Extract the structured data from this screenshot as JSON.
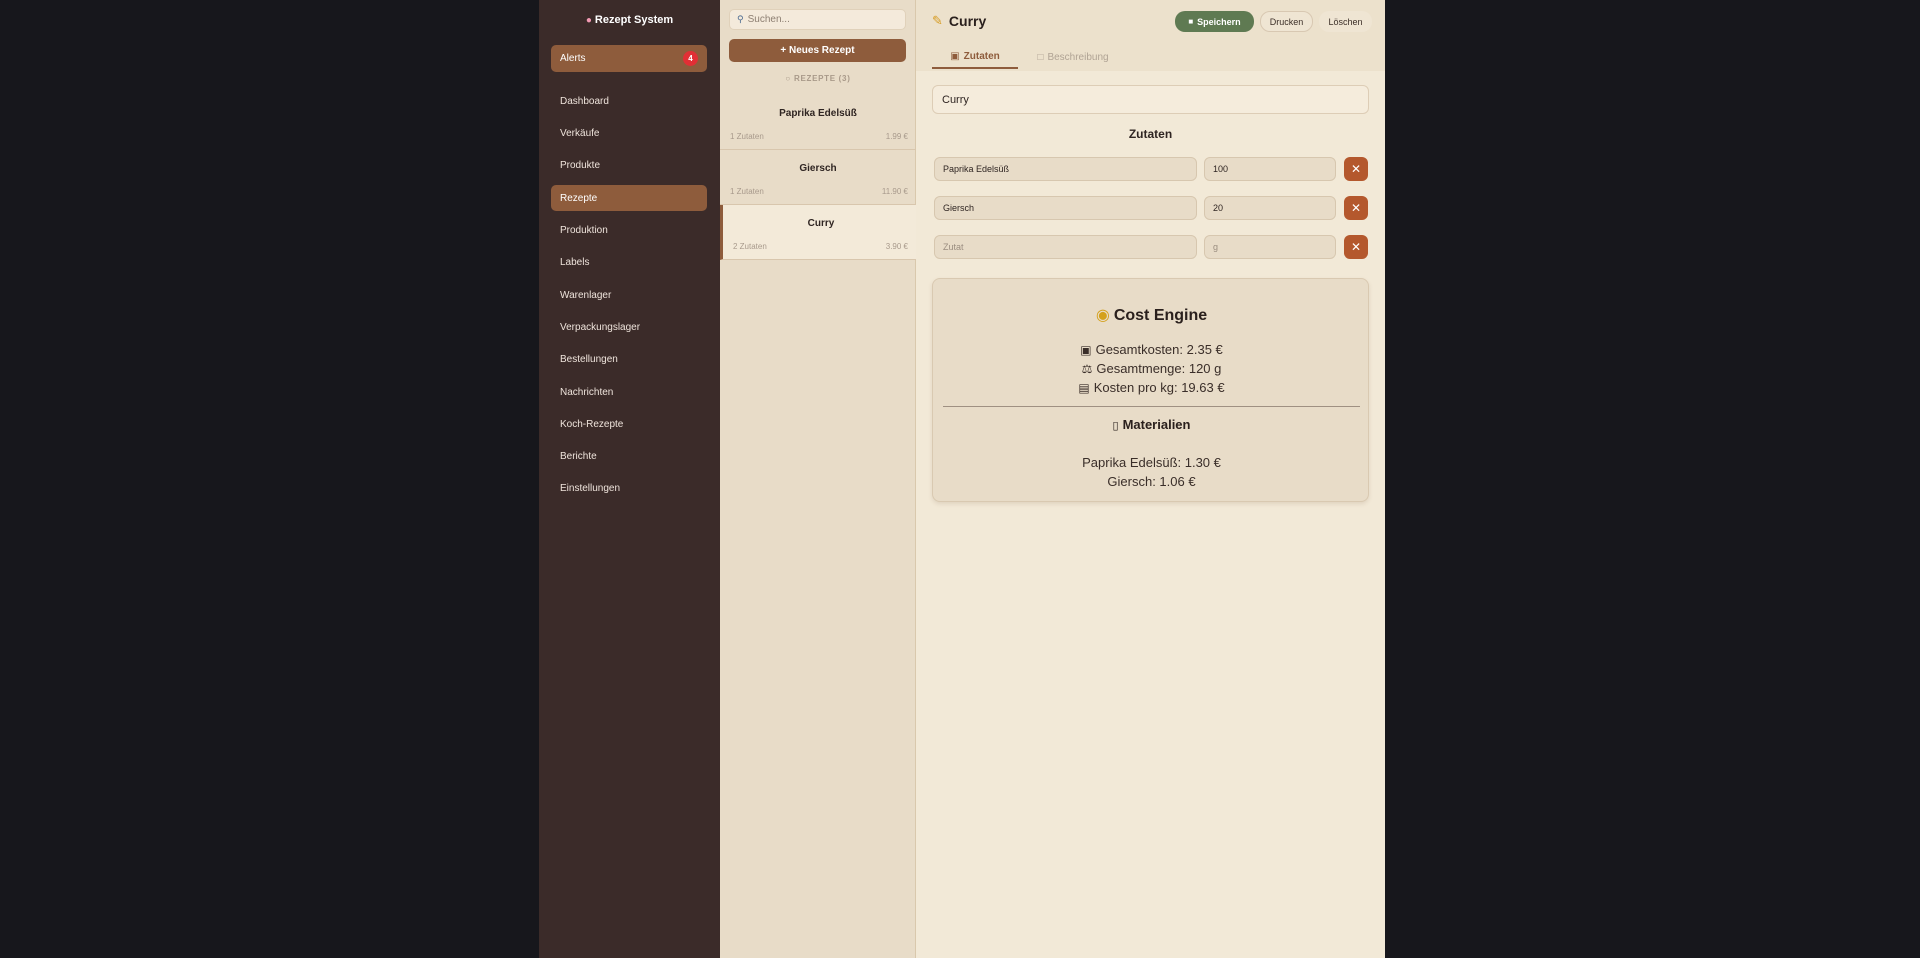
{
  "sidebar": {
    "brand": "Rezept System",
    "alerts_label": "Alerts",
    "alerts_count": "4",
    "items": [
      {
        "label": "Dashboard"
      },
      {
        "label": "Verkäufe"
      },
      {
        "label": "Produkte"
      },
      {
        "label": "Rezepte",
        "active": true
      },
      {
        "label": "Produktion"
      },
      {
        "label": "Labels"
      },
      {
        "label": "Warenlager"
      },
      {
        "label": "Verpackungslager"
      },
      {
        "label": "Bestellungen"
      },
      {
        "label": "Nachrichten"
      },
      {
        "label": "Koch-Rezepte"
      },
      {
        "label": "Berichte"
      },
      {
        "label": "Einstellungen"
      }
    ]
  },
  "list": {
    "search_placeholder": "Suchen...",
    "new_button": "+ Neues Rezept",
    "header": "REZEPTE (3)",
    "recipes": [
      {
        "name": "Paprika Edelsüß",
        "ingredients": "1 Zutaten",
        "price": "1.99 €"
      },
      {
        "name": "Giersch",
        "ingredients": "1 Zutaten",
        "price": "11.90 €"
      },
      {
        "name": "Curry",
        "ingredients": "2 Zutaten",
        "price": "3.90 €",
        "selected": true
      }
    ]
  },
  "editor": {
    "title": "Curry",
    "save_label": "Speichern",
    "print_label": "Drucken",
    "delete_label": "Löschen",
    "tabs": [
      {
        "label": "Zutaten",
        "active": true
      },
      {
        "label": "Beschreibung"
      }
    ],
    "name_value": "Curry",
    "section_title": "Zutaten",
    "ingredients": [
      {
        "name": "Paprika Edelsüß",
        "qty": "100"
      },
      {
        "name": "Giersch",
        "qty": "20"
      }
    ],
    "new_ingredient": {
      "name_placeholder": "Zutat",
      "qty_placeholder": "g"
    }
  },
  "cost_engine": {
    "title": "Cost Engine",
    "total_cost": "Gesamtkosten: 2.35 €",
    "total_amount": "Gesamtmenge: 120 g",
    "cost_per_kg": "Kosten pro kg: 19.63 €",
    "materials_title": "Materialien",
    "materials": [
      "Paprika Edelsüß: 1.30 €",
      "Giersch: 1.06 €"
    ]
  },
  "colors": {
    "accent": "#8e5c3c",
    "sidebar_bg": "#3b2b29",
    "save_green": "#5f7a52",
    "delete_orange": "#b4582d",
    "badge_red": "#e12f35"
  }
}
